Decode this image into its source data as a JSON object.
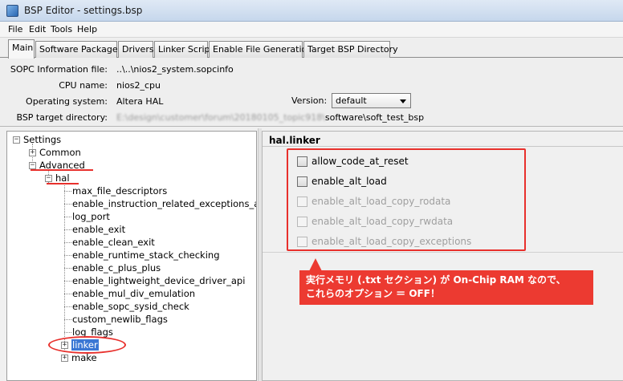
{
  "window": {
    "title": "BSP Editor - settings.bsp"
  },
  "menu": [
    "File",
    "Edit",
    "Tools",
    "Help"
  ],
  "tabs": [
    "Main",
    "Software Packages",
    "Drivers",
    "Linker Script",
    "Enable File Generation",
    "Target BSP Directory"
  ],
  "info": {
    "sopc_label": "SOPC Information file:",
    "sopc_value": "..\\..\\nios2_system.sopcinfo",
    "cpu_label": "CPU name:",
    "cpu_value": "nios2_cpu",
    "os_label": "Operating system:",
    "os_value": "Altera HAL",
    "version_label": "Version:",
    "version_value": "default",
    "bsp_label": "BSP target directory:",
    "bsp_value_blurred": "E:\\design\\customer\\forum\\20180105_topic918\\",
    "bsp_value_tail": "software\\soft_test_bsp"
  },
  "tree": {
    "settings": "Settings",
    "common": "Common",
    "advanced": "Advanced",
    "hal": "hal",
    "hal_children": [
      "max_file_descriptors",
      "enable_instruction_related_exceptions_api",
      "log_port",
      "enable_exit",
      "enable_clean_exit",
      "enable_runtime_stack_checking",
      "enable_c_plus_plus",
      "enable_lightweight_device_driver_api",
      "enable_mul_div_emulation",
      "enable_sopc_sysid_check",
      "custom_newlib_flags",
      "log_flags"
    ],
    "linker": "linker",
    "make": "make"
  },
  "panel": {
    "title": "hal.linker",
    "options": [
      {
        "label": "allow_code_at_reset",
        "enabled": true,
        "checked": false
      },
      {
        "label": "enable_alt_load",
        "enabled": true,
        "checked": false
      },
      {
        "label": "enable_alt_load_copy_rodata",
        "enabled": false,
        "checked": false
      },
      {
        "label": "enable_alt_load_copy_rwdata",
        "enabled": false,
        "checked": false
      },
      {
        "label": "enable_alt_load_copy_exceptions",
        "enabled": false,
        "checked": false
      }
    ]
  },
  "annotation": {
    "line1": "実行メモリ (.txt セクション) が On-Chip RAM なので、",
    "line2": "これらのオプション ＝ OFF！",
    "color": "#ec3a31"
  }
}
